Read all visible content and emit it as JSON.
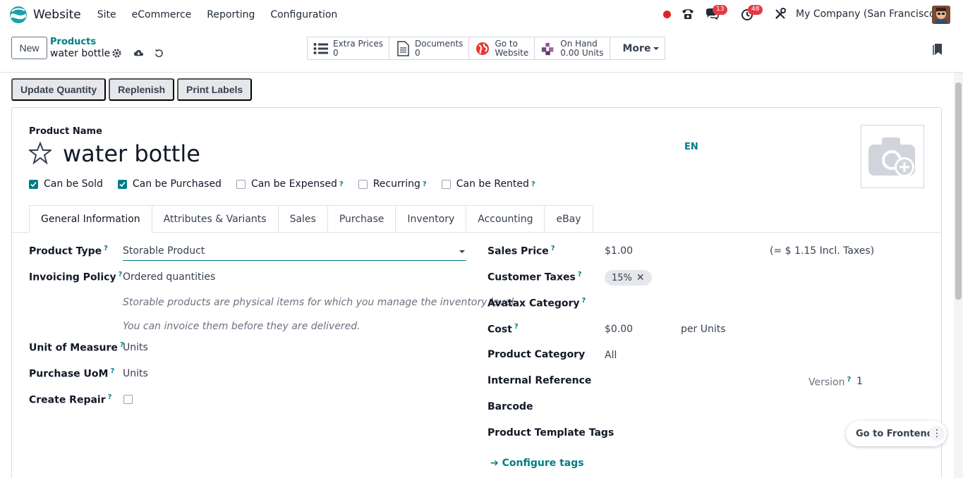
{
  "navbar": {
    "app_name": "Website",
    "menu": [
      "Site",
      "eCommerce",
      "Reporting",
      "Configuration"
    ],
    "chat_count": "13",
    "activity_count": "48",
    "company": "My Company (San Francisco)"
  },
  "control": {
    "new_label": "New",
    "breadcrumb_parent": "Products",
    "breadcrumb_current": "water bottle",
    "smart_buttons": [
      {
        "label": "Extra Prices",
        "value": "0",
        "icon": "list-icon"
      },
      {
        "label": "Documents",
        "value": "0",
        "icon": "document-icon"
      },
      {
        "label": "Go to",
        "value": "Website",
        "icon": "globe-icon"
      },
      {
        "label": "On Hand",
        "value": "0.00 Units",
        "icon": "cubes-icon"
      }
    ],
    "more_label": "More"
  },
  "actions": [
    "Update Quantity",
    "Replenish",
    "Print Labels"
  ],
  "form": {
    "name_label": "Product Name",
    "name": "water bottle",
    "lang": "EN",
    "checkboxes": [
      {
        "label": "Can be Sold",
        "checked": true,
        "help": false
      },
      {
        "label": "Can be Purchased",
        "checked": true,
        "help": false
      },
      {
        "label": "Can be Expensed",
        "checked": false,
        "help": true
      },
      {
        "label": "Recurring",
        "checked": false,
        "help": true
      },
      {
        "label": "Can be Rented",
        "checked": false,
        "help": true
      }
    ],
    "tabs": [
      "General Information",
      "Attributes & Variants",
      "Sales",
      "Purchase",
      "Inventory",
      "Accounting",
      "eBay"
    ],
    "left": {
      "product_type_label": "Product Type",
      "product_type": "Storable Product",
      "invoicing_label": "Invoicing Policy",
      "invoicing": "Ordered quantities",
      "hint1": "Storable products are physical items for which you manage the inventory level.",
      "hint2": "You can invoice them before they are delivered.",
      "uom_label": "Unit of Measure",
      "uom": "Units",
      "purchase_uom_label": "Purchase UoM",
      "purchase_uom": "Units",
      "repair_label": "Create Repair"
    },
    "right": {
      "sales_price_label": "Sales Price",
      "sales_price": "$1.00",
      "incl_taxes": "(= $ 1.15 Incl. Taxes)",
      "customer_taxes_label": "Customer Taxes",
      "tax_tag": "15%",
      "avatax_label": "Avatax Category",
      "cost_label": "Cost",
      "cost": "$0.00",
      "cost_unit": "per Units",
      "category_label": "Product Category",
      "category": "All",
      "internal_ref_label": "Internal Reference",
      "version_label": "Version",
      "version": "1",
      "barcode_label": "Barcode",
      "template_tags_label": "Product Template Tags",
      "configure_tags": "Configure tags"
    }
  },
  "frontend_label": "Go to Frontend"
}
